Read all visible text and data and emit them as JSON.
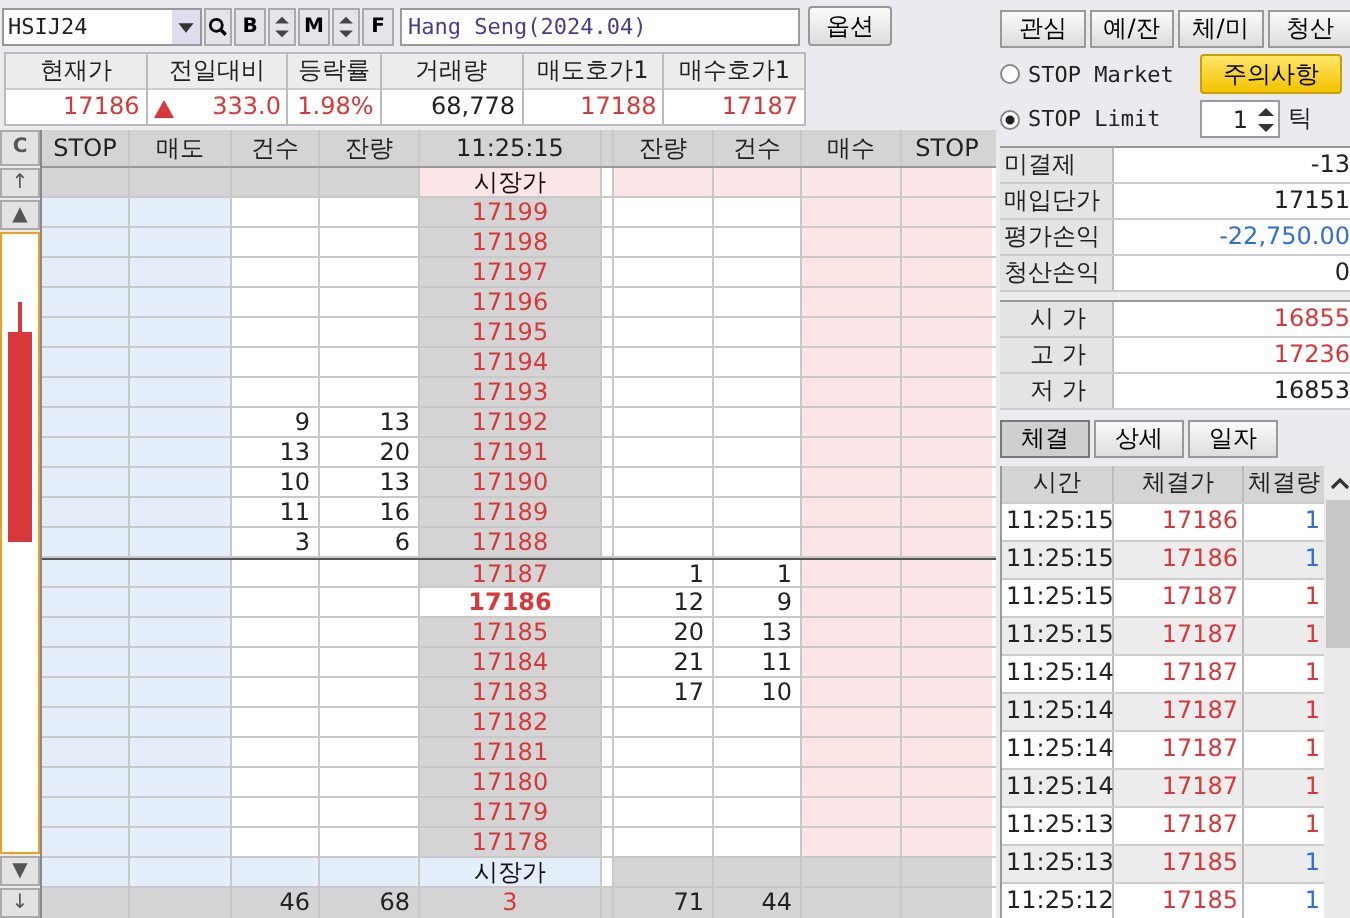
{
  "toolbar": {
    "symbol": "HSIJ24",
    "name": "Hang Seng(2024.04)",
    "buttons": [
      "B",
      "M",
      "F"
    ],
    "option_button": "옵션"
  },
  "quote": {
    "columns": [
      "현재가",
      "전일대비",
      "등락률",
      "거래량",
      "매도호가1",
      "매수호가1"
    ],
    "values": [
      {
        "text": "17186",
        "kind": "up"
      },
      {
        "text": "333.0",
        "kind": "up_arrow"
      },
      {
        "text": "1.98%",
        "kind": "up"
      },
      {
        "text": "68,778",
        "kind": "flat"
      },
      {
        "text": "17188",
        "kind": "up"
      },
      {
        "text": "17187",
        "kind": "up"
      }
    ]
  },
  "orderbook": {
    "side_buttons": [
      "C",
      "↑",
      "▲",
      "▼",
      "↓"
    ],
    "columns": [
      "STOP",
      "매도",
      "건수",
      "잔량",
      "11:25:15",
      "잔량",
      "건수",
      "매수",
      "STOP"
    ],
    "rows": [
      {
        "kind": "market_top",
        "label": "시장가"
      },
      {
        "kind": "price",
        "current": false,
        "price": "17199"
      },
      {
        "kind": "price",
        "current": false,
        "price": "17198"
      },
      {
        "kind": "price",
        "current": false,
        "price": "17197"
      },
      {
        "kind": "price",
        "current": false,
        "price": "17196"
      },
      {
        "kind": "price",
        "current": false,
        "price": "17195"
      },
      {
        "kind": "price",
        "current": false,
        "price": "17194"
      },
      {
        "kind": "price",
        "current": false,
        "price": "17193"
      },
      {
        "kind": "price",
        "current": false,
        "price": "17192",
        "sell_count": "9",
        "sell_qty": "13"
      },
      {
        "kind": "price",
        "current": false,
        "price": "17191",
        "sell_count": "13",
        "sell_qty": "20"
      },
      {
        "kind": "price",
        "current": false,
        "price": "17190",
        "sell_count": "10",
        "sell_qty": "13"
      },
      {
        "kind": "price",
        "current": false,
        "price": "17189",
        "sell_count": "11",
        "sell_qty": "16"
      },
      {
        "kind": "price",
        "current": false,
        "price": "17188",
        "sell_count": "3",
        "sell_qty": "6"
      },
      {
        "kind": "price",
        "current": false,
        "price": "17187",
        "buy_qty": "1",
        "buy_count": "1"
      },
      {
        "kind": "price",
        "current": true,
        "price": "17186",
        "buy_qty": "12",
        "buy_count": "9"
      },
      {
        "kind": "price",
        "current": false,
        "price": "17185",
        "buy_qty": "20",
        "buy_count": "13"
      },
      {
        "kind": "price",
        "current": false,
        "price": "17184",
        "buy_qty": "21",
        "buy_count": "11"
      },
      {
        "kind": "price",
        "current": false,
        "price": "17183",
        "buy_qty": "17",
        "buy_count": "10"
      },
      {
        "kind": "price",
        "current": false,
        "price": "17182"
      },
      {
        "kind": "price",
        "current": false,
        "price": "17181"
      },
      {
        "kind": "price",
        "current": false,
        "price": "17180"
      },
      {
        "kind": "price",
        "current": false,
        "price": "17179"
      },
      {
        "kind": "price",
        "current": false,
        "price": "17178"
      },
      {
        "kind": "market_bottom",
        "label": "시장가"
      }
    ],
    "totals": {
      "sell_count": "46",
      "sell_qty": "68",
      "center": "3",
      "buy_qty": "71",
      "buy_count": "44"
    }
  },
  "right": {
    "tabs": [
      "관심",
      "예/잔",
      "체/미",
      "청산"
    ],
    "radios": [
      {
        "label": "STOP Market",
        "checked": false
      },
      {
        "label": "STOP Limit",
        "checked": true
      }
    ],
    "notice_button": "주의사항",
    "tick_value": "1",
    "tick_unit": "틱",
    "account": [
      {
        "label": "미결제",
        "value": "-13",
        "kind": "flat"
      },
      {
        "label": "매입단가",
        "value": "17151",
        "kind": "flat"
      },
      {
        "label": "평가손익",
        "value": "-22,750.00",
        "kind": "down"
      },
      {
        "label": "청산손익",
        "value": "0",
        "kind": "flat"
      }
    ],
    "prices": [
      {
        "label": "시 가",
        "value": "16855",
        "kind": "up"
      },
      {
        "label": "고 가",
        "value": "17236",
        "kind": "up"
      },
      {
        "label": "저 가",
        "value": "16853",
        "kind": "flat"
      }
    ],
    "view_tabs": [
      {
        "label": "체결",
        "selected": true
      },
      {
        "label": "상세",
        "selected": false
      },
      {
        "label": "일자",
        "selected": false
      }
    ],
    "trades": {
      "columns": [
        "시간",
        "체결가",
        "체결량"
      ],
      "rows": [
        {
          "time": "11:25:15",
          "price": "17186",
          "qty": "1",
          "color": "#2f6fd6"
        },
        {
          "time": "11:25:15",
          "price": "17186",
          "qty": "1",
          "color": "#2f6fd6"
        },
        {
          "time": "11:25:15",
          "price": "17187",
          "qty": "1",
          "color": "#d9383a"
        },
        {
          "time": "11:25:15",
          "price": "17187",
          "qty": "1",
          "color": "#d9383a"
        },
        {
          "time": "11:25:14",
          "price": "17187",
          "qty": "1",
          "color": "#d9383a"
        },
        {
          "time": "11:25:14",
          "price": "17187",
          "qty": "1",
          "color": "#d9383a"
        },
        {
          "time": "11:25:14",
          "price": "17187",
          "qty": "1",
          "color": "#d9383a"
        },
        {
          "time": "11:25:14",
          "price": "17187",
          "qty": "1",
          "color": "#d9383a"
        },
        {
          "time": "11:25:13",
          "price": "17187",
          "qty": "1",
          "color": "#d9383a"
        },
        {
          "time": "11:25:13",
          "price": "17185",
          "qty": "1",
          "color": "#2f6fd6"
        },
        {
          "time": "11:25:12",
          "price": "17185",
          "qty": "1",
          "color": "#2f6fd6"
        }
      ]
    }
  }
}
